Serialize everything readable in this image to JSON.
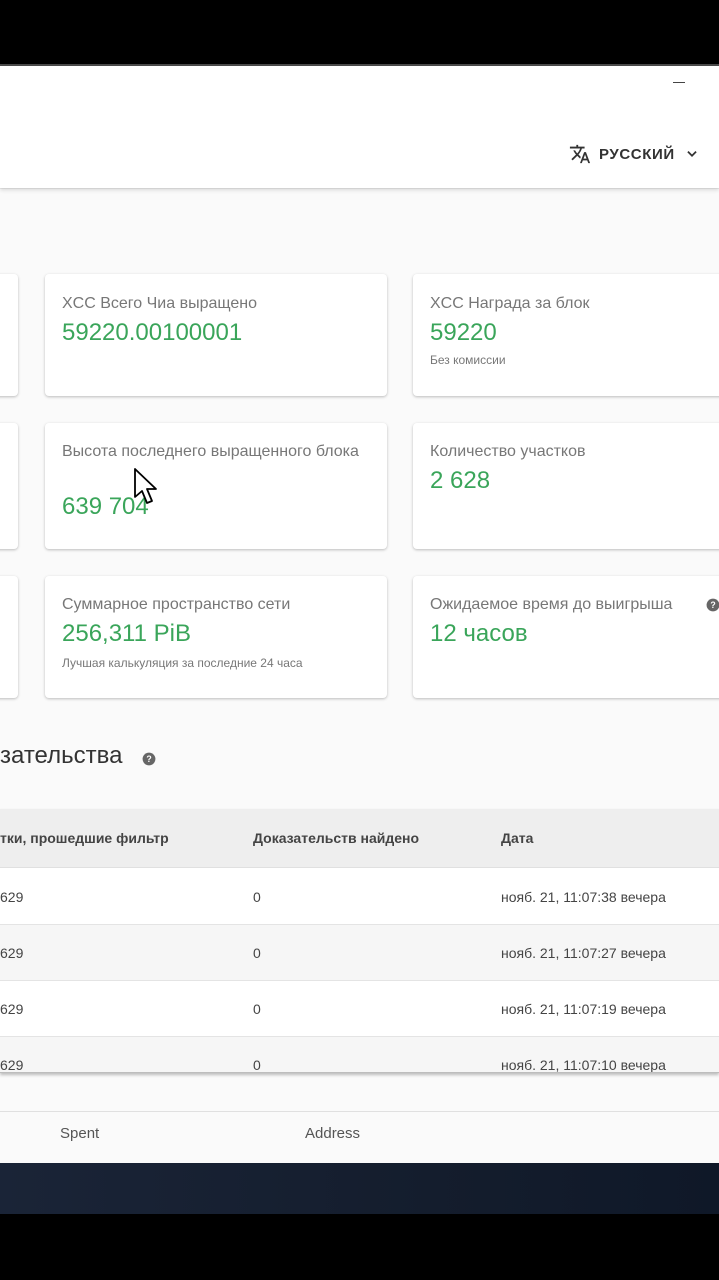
{
  "header": {
    "language_icon": "translate-icon",
    "language_label": "РУССКИЙ",
    "language_dropdown_icon": "chevron-down-icon",
    "minimize_icon": "minimize-icon"
  },
  "stats": [
    {
      "label": "XCC Всего Чиа выращено",
      "value": "59220.00100001",
      "sub": ""
    },
    {
      "label": "XCC Награда за блок",
      "value": "59220",
      "sub": "Без комиссии"
    },
    {
      "label": "Высота последнего выращенного блока",
      "value": "639 704",
      "sub": ""
    },
    {
      "label": "Количество участков",
      "value": "2 628",
      "sub": ""
    },
    {
      "label": "Суммарное пространство сети",
      "value": "256,311 PiB",
      "sub": "Лучшая калькуляция за последние 24 часа"
    },
    {
      "label": "Ожидаемое время до выигрыша",
      "value": "12 часов",
      "sub": "",
      "help_icon": "help-icon"
    }
  ],
  "proofs": {
    "title": "зательства",
    "help_icon": "help-icon",
    "columns": [
      "тки, прошедшие фильтр",
      "Доказательств найдено",
      "Дата"
    ],
    "rows": [
      [
        "629",
        "0",
        "нояб. 21, 11:07:38 вечера"
      ],
      [
        "629",
        "0",
        "нояб. 21, 11:07:27 вечера"
      ],
      [
        "629",
        "0",
        "нояб. 21, 11:07:19 вечера"
      ],
      [
        "629",
        "0",
        "нояб. 21, 11:07:10 вечера"
      ]
    ]
  },
  "background_table": {
    "columns": [
      "Spent",
      "Address"
    ]
  },
  "colors": {
    "accent_green": "#3aa55a",
    "label_gray": "#777777",
    "taskbar": "#1a2437"
  }
}
